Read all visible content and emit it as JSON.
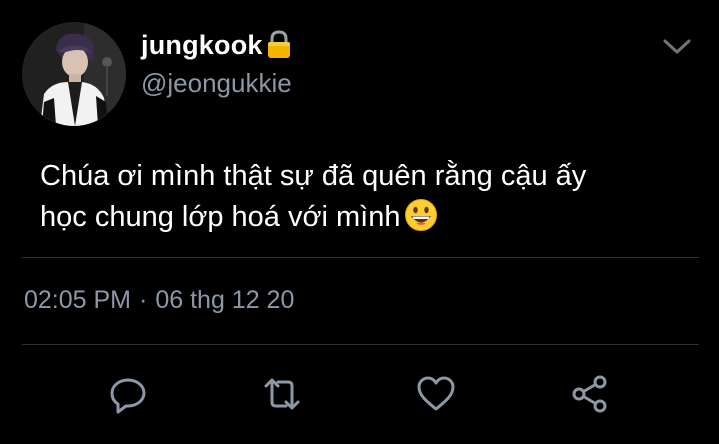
{
  "user": {
    "display_name": "jungkook",
    "handle": "@jeongukkie",
    "protected": true
  },
  "tweet": {
    "line1": "Chúa ơi mình thật sự đã quên rằng cậu ấy",
    "line2": "học chung lớp hoá với mình"
  },
  "meta": {
    "time": "02:05 PM",
    "separator": "·",
    "date": "06 thg 12 20"
  },
  "icons": {
    "lock": "lock-icon",
    "emoji": "grinning-face-emoji",
    "menu": "chevron-down-icon",
    "reply": "reply-icon",
    "retweet": "retweet-icon",
    "like": "heart-icon",
    "share": "share-icon"
  },
  "colors": {
    "background": "#000000",
    "text": "#ffffff",
    "secondary_text": "#8b98a5",
    "divider": "#2f3336",
    "lock": "#f4b400"
  }
}
